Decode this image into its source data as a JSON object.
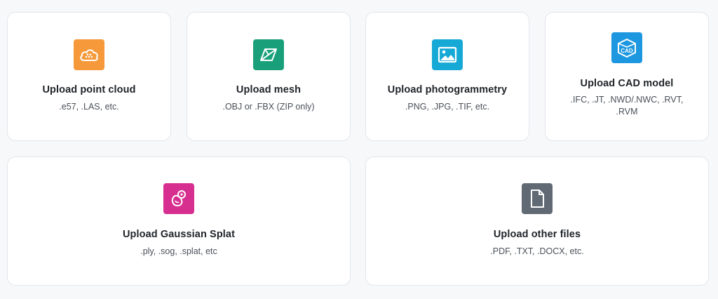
{
  "cards": [
    {
      "title": "Upload point cloud",
      "subtitle": ".e57, .LAS, etc.",
      "icon": "cloud-icon",
      "color": "#f5993a"
    },
    {
      "title": "Upload mesh",
      "subtitle": ".OBJ or .FBX (ZIP only)",
      "icon": "mesh-icon",
      "color": "#19a07a"
    },
    {
      "title": "Upload photogrammetry",
      "subtitle": ".PNG, .JPG, .TIF, etc.",
      "icon": "image-icon",
      "color": "#17a9d6"
    },
    {
      "title": "Upload CAD model",
      "subtitle": ".IFC, .JT, .NWD/.NWC, .RVT, .RVM",
      "icon": "cad-icon",
      "icon_text": "CAD",
      "color": "#1c97e0"
    },
    {
      "title": "Upload Gaussian Splat",
      "subtitle": ".ply, .sog, .splat, etc",
      "icon": "splat-icon",
      "color": "#d62f8f"
    },
    {
      "title": "Upload other files",
      "subtitle": ".PDF, .TXT, .DOCX, etc.",
      "icon": "file-icon",
      "color": "#616975"
    }
  ]
}
